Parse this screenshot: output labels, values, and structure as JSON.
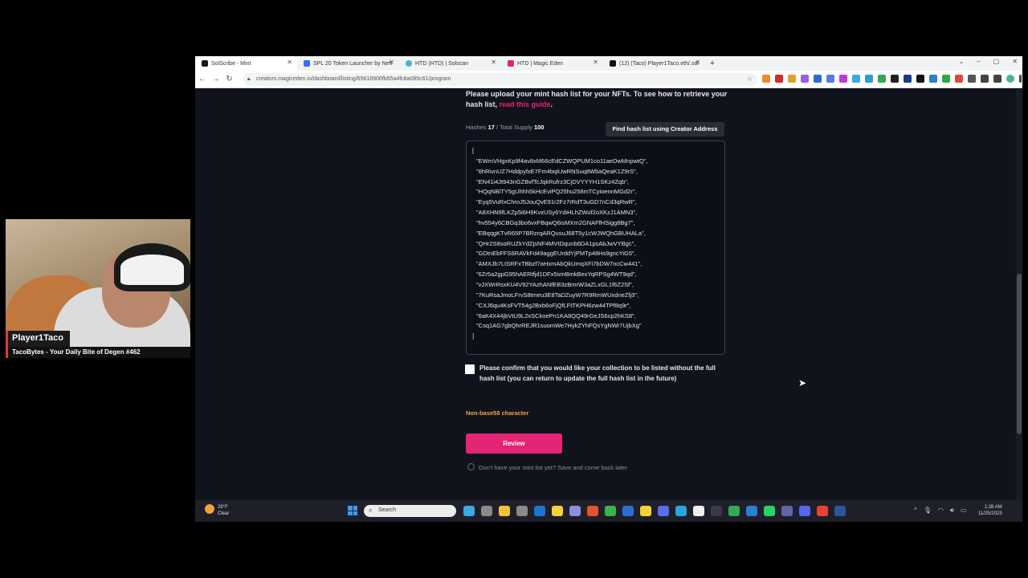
{
  "webcam": {
    "name": "Player1Taco",
    "subtitle": "TacoBytes - Your Daily Bite of Degen #462"
  },
  "browser": {
    "tabs": [
      {
        "label": "SolScribe - Mint",
        "active": true,
        "color": "#1a1a1a"
      },
      {
        "label": "SPL 20 Token Launcher by Neft",
        "active": false,
        "color": "#3b6cf2"
      },
      {
        "label": "HTD (HTD) | Solscan",
        "active": false,
        "color": "#4bb4c8"
      },
      {
        "label": "HTD | Magic Eden",
        "active": false,
        "color": "#e42575"
      },
      {
        "label": "(12) (Taco) Player1Taco.eth/.sol",
        "active": false,
        "color": "#111"
      }
    ],
    "new_tab": "+",
    "url": "creators.magiceden.io/dashboard/listing/65618906fb65a4fc8a085c61/program",
    "window_controls": [
      "⌄",
      "–",
      "▢",
      "✕"
    ]
  },
  "page": {
    "intro_text": "Please upload your mint hash list for your NFTs. To see how to retrieve your hash list,",
    "intro_link": "read this guide",
    "intro_end": ".",
    "hashes_label": "Hashes",
    "hashes_count": "17",
    "supply_label": "/ Total Supply",
    "supply_count": "100",
    "find_button": "Find hash list using Creator Address",
    "hash_open": "[",
    "hashes": [
      "\"EWmVHgxKp9f4av8xM66cEdCZWQPUM1co11aeDwMnpwtQ\",",
      "\"6hRivnUZ7HddpyfxE7Fm4bqiUwRNSuq8WbaQeaK1Z9rS\",",
      "\"EN41i4Jt943nGZBvfTcJqkRufrz3CjDVYYYH1SKz4Zqb\",",
      "\"HQqNBiTY5gUhhh5kHcEviPQ25hu258mTCyioennMGd2r\",",
      "\"Eyq5VuRxChroJ5JouQvE91r2Fz7rRdT3uGD7nCd3qRwR\",",
      "\"A8XHN9fLKZp5i6H9KvxUSy6YdiHLhZWuf2oXKzJ1AMN3\",",
      "\"hv554y6CBGq3bo6vxFBqwQ6isMXm2GNAFfHSigg8Bg7\",",
      "\"EBqqgKTvR65P7BRzrqARQusuJ68T5y1cWJWQhGBUHALa\",",
      "\"QHr2S8soRUZkYdZjsNF4MVtDqunb6DA1psAbJwVYBgc\",",
      "\"GDtnEbFFS6RAVkFd49aggEUrddYjPMTp48Hs9gncYiG5\",",
      "\"AMXJb7LtSRFxTBbzf7aHxmAbQkUmqXFi7bDW7ncCw441\",",
      "\"6Zr5a2gpG95hAERtfjd1DFx5smBmkBexYqRPSg4WT9qd\",",
      "\"vJXWrRsxKU4V92YAzhANfEB3zBmrW3aZLxGL1f6Z2Sf\",",
      "\"7KuRsaJmoLFrvS8tmeu3E8TaDZuyW7R9RmWUxdneZfj3\",",
      "\"CXJ6qu4KsFVT54g2Bxb6oFjQfLFtTKPH6zw44TPf8q9r\",",
      "\"6aK4X44jbVtU9L2xSCkoePn1KA8QQ49rGeJS6cp2hKS8\",",
      "\"Csq1AG7gbQhrREJR1suomWe7HykZYhFQsYgNWr7UjbXg\""
    ],
    "hash_close": "]",
    "confirm_text": "Please confirm that you would like your collection to be listed without the full hash list (you can return to update the full hash list in the future)",
    "error_text": "Non-base58 character",
    "review_button": "Review",
    "later_text": "Don't have your mint list yet? Save and come back later"
  },
  "taskbar": {
    "weather_temp": "29°F",
    "weather_desc": "Clear",
    "search_placeholder": "Search",
    "time": "1:28 AM",
    "date": "11/25/2023",
    "app_colors": [
      "#3fa8e0",
      "#8a8a8a",
      "#f3c23a",
      "#8a8a8a",
      "#1f73d1",
      "#f3d23a",
      "#8a8fdd",
      "#e2542a",
      "#38b54a",
      "#2c6fd1",
      "#f3d23a",
      "#5a6cf0",
      "#2aa5e0",
      "#f0f0f0",
      "#3a3a4a",
      "#34a853",
      "#2a7fd1",
      "#25d366",
      "#6264a7",
      "#5865f2",
      "#ea4335",
      "#2b579a"
    ]
  }
}
